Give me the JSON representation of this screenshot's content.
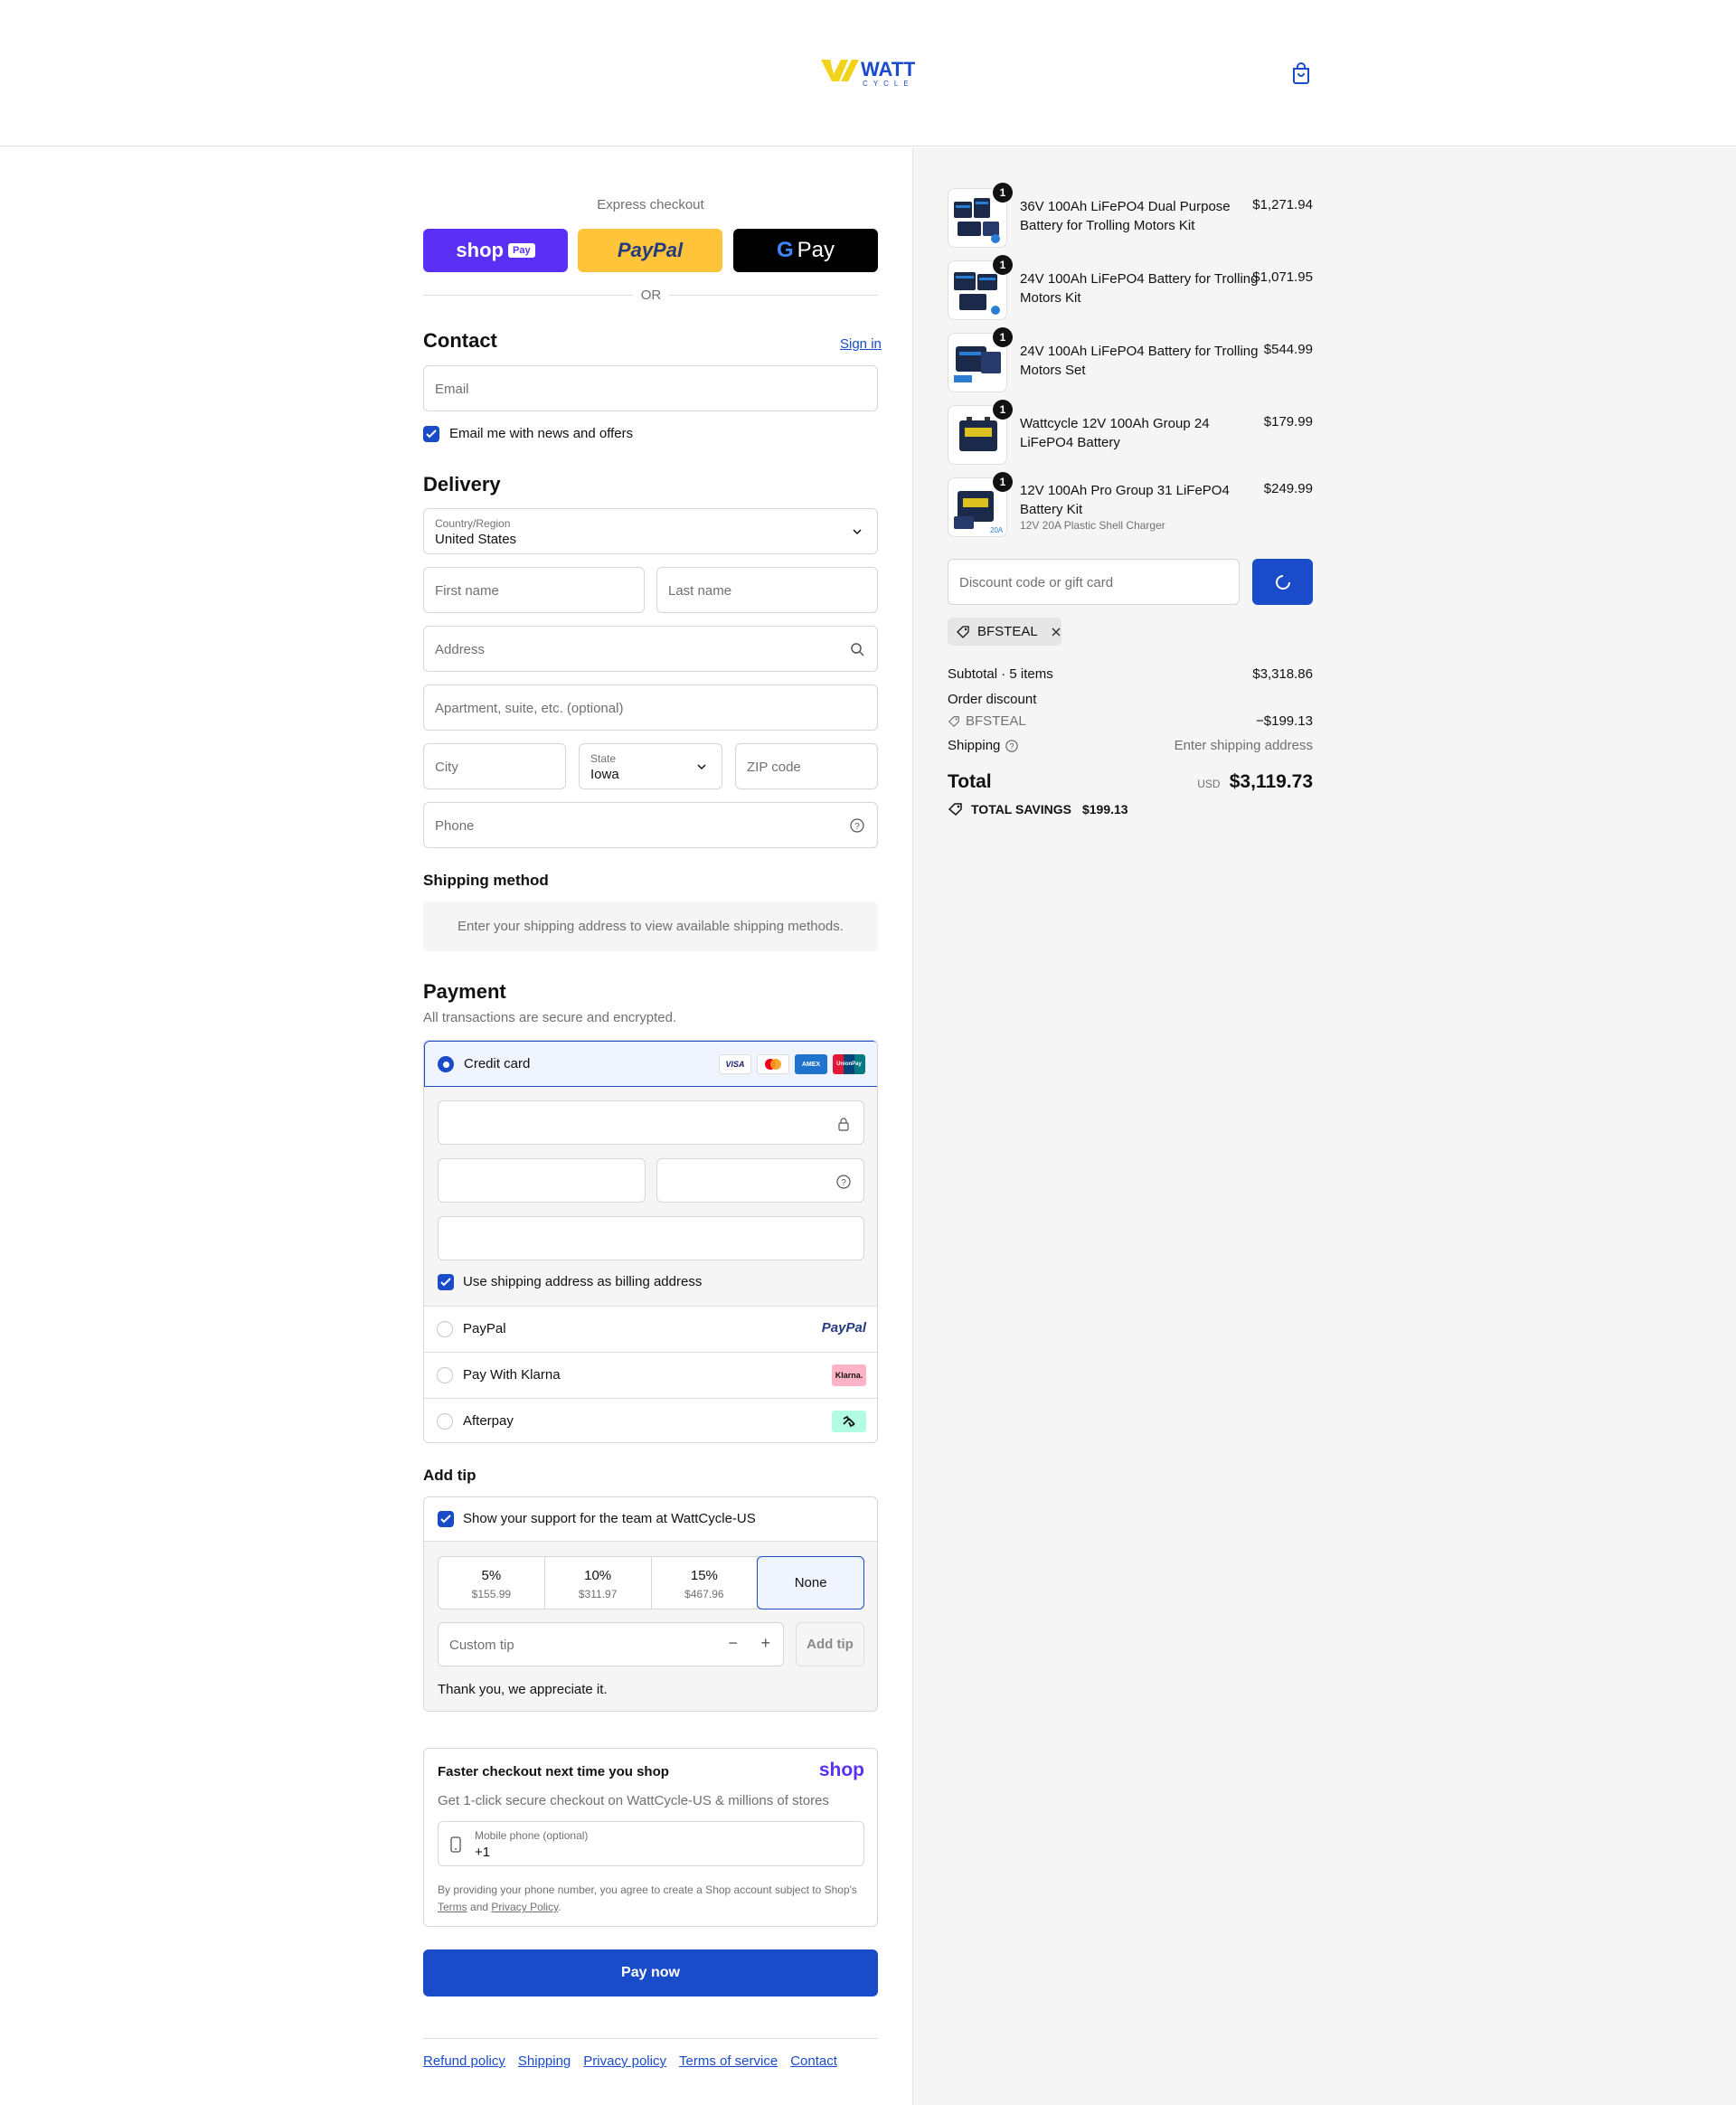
{
  "brand": {
    "logo_top": "WATT",
    "logo_bottom": "CYCLE"
  },
  "express": {
    "label": "Express checkout",
    "shoppay_text": "shop",
    "shoppay_badge": "Pay",
    "paypal_text": "PayPal",
    "gpay_text": "Pay",
    "or": "OR"
  },
  "contact": {
    "title": "Contact",
    "sign_in": "Sign in",
    "email_placeholder": "Email",
    "newsletter_label": "Email me with news and offers"
  },
  "delivery": {
    "title": "Delivery",
    "country_label": "Country/Region",
    "country_value": "United States",
    "first_name": "First name",
    "last_name": "Last name",
    "address": "Address",
    "apartment": "Apartment, suite, etc. (optional)",
    "city": "City",
    "state_label": "State",
    "state_value": "Iowa",
    "zip": "ZIP code",
    "phone": "Phone"
  },
  "shipping_method": {
    "title": "Shipping method",
    "notice": "Enter your shipping address to view available shipping methods."
  },
  "payment": {
    "title": "Payment",
    "subtitle": "All transactions are secure and encrypted.",
    "credit_card": "Credit card",
    "card_logos": [
      "VISA",
      "Mastercard",
      "AMEX",
      "UnionPay"
    ],
    "billing_same": "Use shipping address as billing address",
    "paypal": "PayPal",
    "paypal_logo": "PayPal",
    "klarna": "Pay With Klarna",
    "klarna_logo": "Klarna.",
    "afterpay": "Afterpay"
  },
  "tip": {
    "title": "Add tip",
    "support_label": "Show your support for the team at WattCycle-US",
    "options": [
      {
        "percent": "5%",
        "amount": "$155.99"
      },
      {
        "percent": "10%",
        "amount": "$311.97"
      },
      {
        "percent": "15%",
        "amount": "$467.96"
      }
    ],
    "none": "None",
    "custom_placeholder": "Custom tip",
    "add_button": "Add tip",
    "thanks": "Thank you, we appreciate it."
  },
  "shop": {
    "title": "Faster checkout next time you shop",
    "logo": "shop",
    "subtitle": "Get 1-click secure checkout on WattCycle-US & millions of stores",
    "phone_label": "Mobile phone (optional)",
    "phone_value": "+1",
    "legal_1": "By providing your phone number, you agree to create a Shop account subject to Shop's",
    "terms": "Terms",
    "and": "and",
    "privacy": "Privacy Policy",
    "period": "."
  },
  "pay_now": "Pay now",
  "footer": [
    "Refund policy",
    "Shipping",
    "Privacy policy",
    "Terms of service",
    "Contact"
  ],
  "order": {
    "items": [
      {
        "qty": "1",
        "name": "36V 100Ah LiFePO4 Dual Purpose Battery for Trolling Motors Kit",
        "sub": "",
        "price": "$1,271.94"
      },
      {
        "qty": "1",
        "name": "24V 100Ah LiFePO4 Battery for Trolling Motors Kit",
        "sub": "",
        "price": "$1,071.95"
      },
      {
        "qty": "1",
        "name": "24V 100Ah LiFePO4 Battery for Trolling Motors Set",
        "sub": "",
        "price": "$544.99"
      },
      {
        "qty": "1",
        "name": "Wattcycle 12V 100Ah Group 24 LiFePO4 Battery",
        "sub": "",
        "price": "$179.99"
      },
      {
        "qty": "1",
        "name": "12V 100Ah Pro Group 31 LiFePO4 Battery Kit",
        "sub": "12V 20A Plastic Shell Charger",
        "price": "$249.99"
      }
    ],
    "discount_placeholder": "Discount code or gift card",
    "applied_code": "BFSTEAL",
    "subtotal_label": "Subtotal · 5 items",
    "subtotal_value": "$3,318.86",
    "order_discount_label": "Order discount",
    "code_label": "BFSTEAL",
    "discount_value": "−$199.13",
    "shipping_label": "Shipping",
    "shipping_value": "Enter shipping address",
    "total_label": "Total",
    "currency": "USD",
    "total_value": "$3,119.73",
    "savings_label": "TOTAL SAVINGS",
    "savings_value": "$199.13"
  },
  "colors": {
    "accent": "#1a4bc9",
    "shoppay": "#5a31f4",
    "paypal": "#ffc439",
    "logo_yellow": "#f2d21b",
    "logo_blue": "#1a4bc9"
  }
}
